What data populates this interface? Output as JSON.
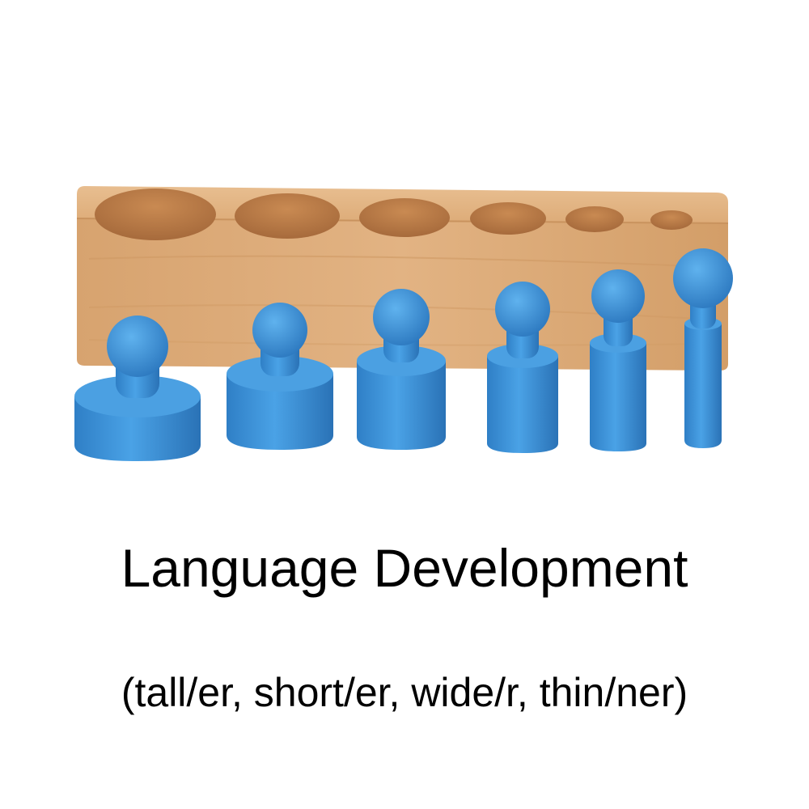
{
  "caption": {
    "title": "Language Development",
    "subtitle": "(tall/er, short/er, wide/r, thin/ner)"
  },
  "colors": {
    "background": "#ffffff",
    "wood": "#d9a36e",
    "cylinder": "#3b8fd6",
    "text": "#000000"
  },
  "illustration": {
    "subject": "wooden knobbed cylinder block with six blue cylinders"
  }
}
